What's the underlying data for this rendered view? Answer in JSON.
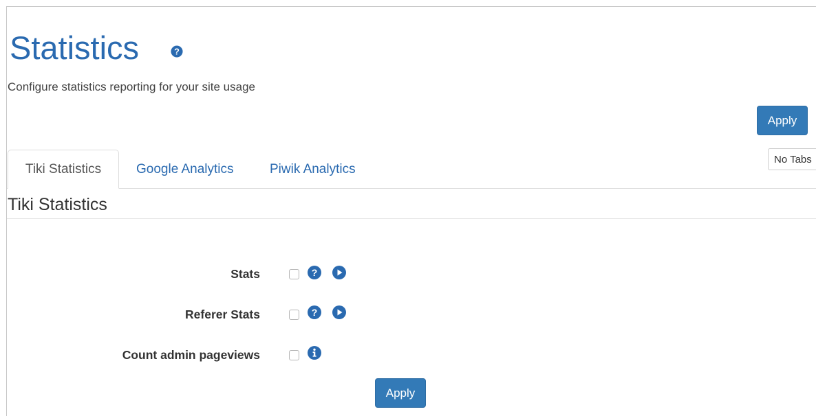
{
  "page": {
    "title": "Statistics",
    "subtitle": "Configure statistics reporting for your site usage"
  },
  "toolbar": {
    "apply_label": "Apply",
    "no_tabs_label": "No Tabs"
  },
  "tabs": [
    {
      "label": "Tiki Statistics",
      "active": true
    },
    {
      "label": "Google Analytics",
      "active": false
    },
    {
      "label": "Piwik Analytics",
      "active": false
    }
  ],
  "section": {
    "title": "Tiki Statistics"
  },
  "settings": [
    {
      "label": "Stats",
      "checked": false,
      "icons": [
        "help-icon",
        "play-icon"
      ]
    },
    {
      "label": "Referer Stats",
      "checked": false,
      "icons": [
        "help-icon",
        "play-icon"
      ]
    },
    {
      "label": "Count admin pageviews",
      "checked": false,
      "icons": [
        "info-icon"
      ]
    }
  ],
  "footer": {
    "apply_label": "Apply"
  },
  "colors": {
    "accent": "#2a6ab0",
    "button": "#337ab7"
  }
}
